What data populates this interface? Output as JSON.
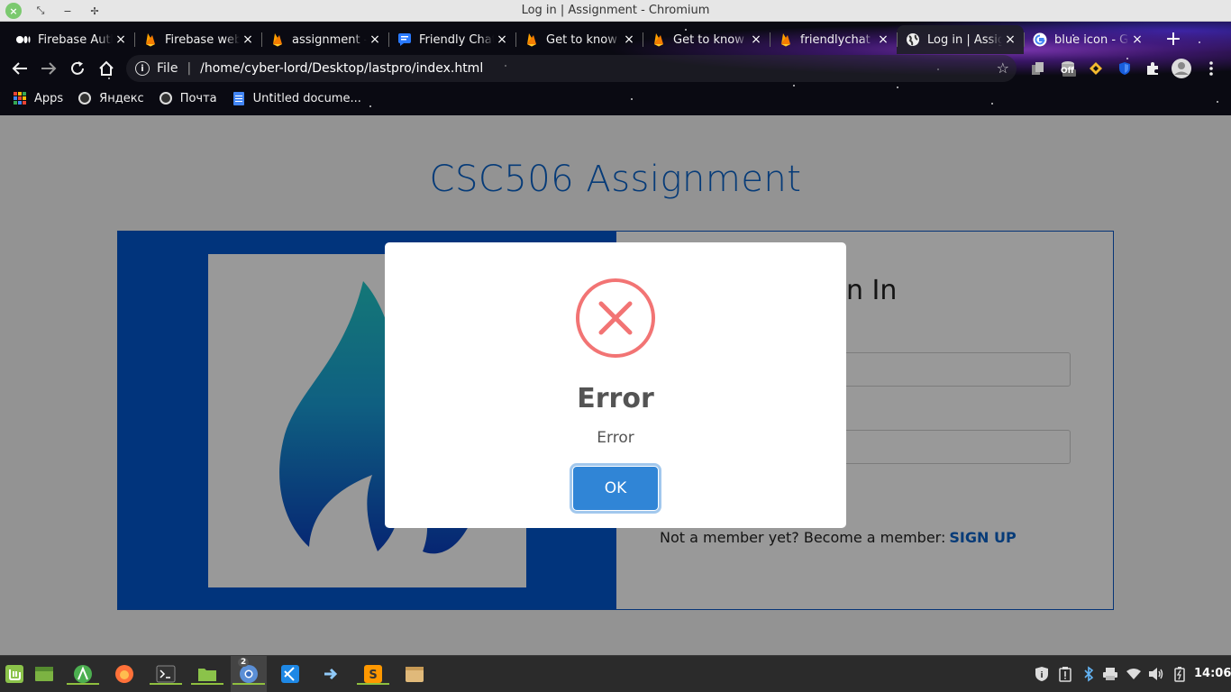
{
  "window": {
    "title": "Log in | Assignment - Chromium"
  },
  "tabs": [
    {
      "title": "Firebase Auth",
      "icon": "medium-icon",
      "active": false
    },
    {
      "title": "Firebase web",
      "icon": "firebase-icon",
      "active": false
    },
    {
      "title": "assignment -",
      "icon": "firebase-icon",
      "active": false
    },
    {
      "title": "Friendly Chat",
      "icon": "chat-icon",
      "active": false
    },
    {
      "title": "Get to know",
      "icon": "firebase-icon",
      "active": false
    },
    {
      "title": "Get to know",
      "icon": "firebase-icon",
      "active": false
    },
    {
      "title": "friendlychat -",
      "icon": "firebase-icon",
      "active": false
    },
    {
      "title": "Log in | Assig",
      "icon": "globe-icon",
      "active": true
    },
    {
      "title": "blue icon - Go",
      "icon": "google-icon",
      "active": false
    }
  ],
  "omnibox": {
    "scheme_label": "File",
    "separator": "|",
    "url": "/home/cyber-lord/Desktop/lastpro/index.html"
  },
  "extensions": {
    "off_badge": "Off"
  },
  "bookmarks": [
    {
      "label": "Apps",
      "icon": "apps-grid-icon"
    },
    {
      "label": "Яндекс",
      "icon": "globe-icon"
    },
    {
      "label": "Почта",
      "icon": "globe-icon"
    },
    {
      "label": "Untitled docume...",
      "icon": "google-doc-icon"
    }
  ],
  "page": {
    "heading": "CSC506 Assignment",
    "signin_title": "Sign In",
    "signup_prompt": "Not a member yet? Become a member:",
    "signup_link": "SIGN UP"
  },
  "modal": {
    "icon": "error-x-icon",
    "title": "Error",
    "text": "Error",
    "ok_label": "OK"
  },
  "taskbar": {
    "window_count_badge": "2",
    "clock": "14:06"
  },
  "colors": {
    "accent_blue": "#0b63c9",
    "panel_blue": "#0258cf",
    "error_red": "#f27474",
    "ok_button": "#3085d6"
  }
}
